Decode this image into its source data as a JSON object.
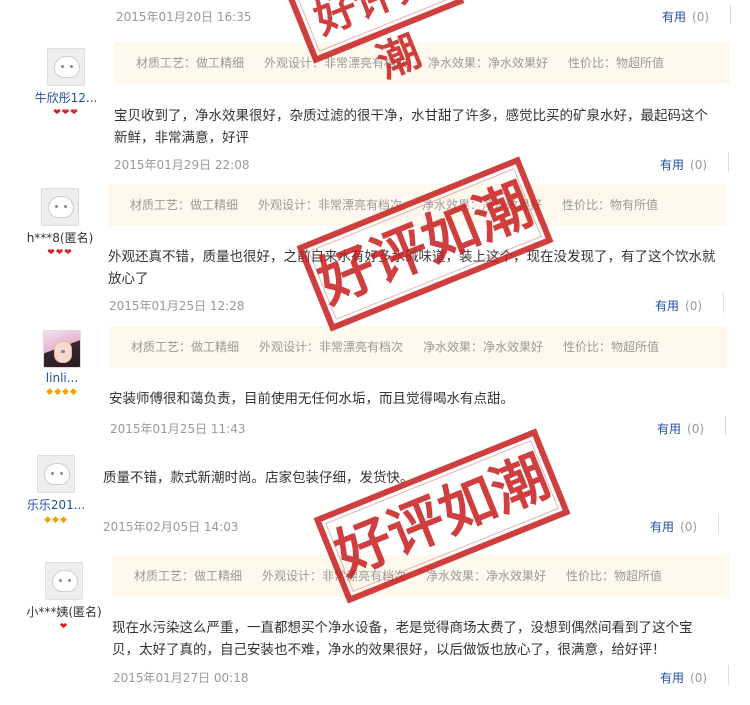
{
  "stamp_text": "好评如潮",
  "colors": {
    "link": "#1f4ea8",
    "stamp": "#c81e1e",
    "tag_bg": "#fff8ee",
    "muted": "#999999"
  },
  "reviews": [
    {
      "date": "2015年01月20日 16:35",
      "useful_label": "有用",
      "useful_count": "(0)"
    },
    {
      "username": "牛欣彤12...",
      "rank_icon": "red-heart-rank",
      "tags": [
        "材质工艺：做工精细",
        "外观设计：非常漂亮有档次",
        "净水效果：净水效果好",
        "性价比：物超所值"
      ],
      "content": "宝贝收到了，净水效果很好，杂质过滤的很干净，水甘甜了许多，感觉比买的矿泉水好，最起码这个新鲜，非常满意，好评",
      "date": "2015年01月29日 22:08",
      "useful_label": "有用",
      "useful_count": "(0)"
    },
    {
      "username": "h***8(匿名)",
      "rank_icon": "red-heart-rank",
      "tags": [
        "材质工艺：做工精细",
        "外观设计：非常漂亮有档次",
        "净水效果：净水效果好",
        "性价比：物有所值"
      ],
      "content": "外观还真不错，质量也很好，之前自来水有好多水碱味道，装上这个，现在没发现了，有了这个饮水就放心了",
      "date": "2015年01月25日 12:28",
      "useful_label": "有用",
      "useful_count": "(0)"
    },
    {
      "username": "linli...",
      "rank_icon": "gold-diamond-rank",
      "tags": [
        "材质工艺：做工精细",
        "外观设计：非常漂亮有档次",
        "净水效果：净水效果好",
        "性价比：物超所值"
      ],
      "content": "安装师傅很和蔼负责，目前使用无任何水垢，而且觉得喝水有点甜。",
      "date": "2015年01月25日 11:43",
      "useful_label": "有用",
      "useful_count": "(0)"
    },
    {
      "username": "乐乐201...",
      "rank_icon": "gold-diamond-rank",
      "content": "质量不错，款式新潮时尚。店家包装仔细，发货快。",
      "date": "2015年02月05日 14:03",
      "useful_label": "有用",
      "useful_count": "(0)"
    },
    {
      "username": "小***姨(匿名)",
      "rank_icon": "red-heart-rank",
      "tags": [
        "材质工艺：做工精细",
        "外观设计：非常漂亮有档次",
        "净水效果：净水效果好",
        "性价比：物超所值"
      ],
      "content": "现在水污染这么严重，一直都想买个净水设备，老是觉得商场太费了，没想到偶然间看到了这个宝贝，太好了真的，自己安装也不难，净水的效果很好，以后做饭也放心了，很满意，给好评！",
      "date": "2015年01月27日 00:18",
      "useful_label": "有用",
      "useful_count": "(0)"
    }
  ]
}
